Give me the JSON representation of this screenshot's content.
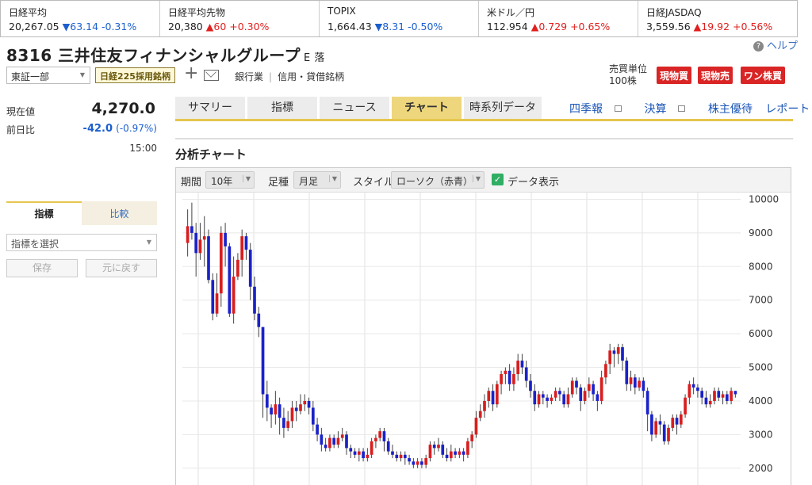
{
  "ticker": [
    {
      "name": "日経平均",
      "value": "20,267.05",
      "dir": "down",
      "change": "▼63.14 -0.31%"
    },
    {
      "name": "日経平均先物",
      "value": "20,380",
      "dir": "up",
      "change": "▲60 +0.30%"
    },
    {
      "name": "TOPIX",
      "value": "1,664.43",
      "dir": "down",
      "change": "▼8.31 -0.50%"
    },
    {
      "name": "米ドル／円",
      "value": "112.954",
      "dir": "up",
      "change": "▲0.729 +0.65%"
    },
    {
      "name": "日経JASDAQ",
      "value": "3,559.56",
      "dir": "up",
      "change": "▲19.92 +0.56%"
    }
  ],
  "help_label": "ヘルプ",
  "stock": {
    "code_name": "8316 三井住友フィナンシャルグループ",
    "market_mark": "E 落",
    "market": "東証一部",
    "nikkei225": "日経225採用銘柄",
    "industry": "銀行業",
    "margin": "信用・貸借銘柄",
    "unit_label": "売買単位",
    "unit_value": "100株",
    "buy_label": "現物買",
    "sell_label": "現物売",
    "one_label": "ワン株買"
  },
  "price": {
    "current_label": "現在値",
    "current": "4,270.0",
    "prev_label": "前日比",
    "change": "-42.0",
    "change_pct": "(-0.97%)",
    "time": "15:00"
  },
  "indicator_panel": {
    "tab_indicator": "指標",
    "tab_compare": "比較",
    "select_placeholder": "指標を選択",
    "save": "保存",
    "reset": "元に戻す"
  },
  "tabs": [
    "サマリー",
    "指標",
    "ニュース",
    "チャート",
    "時系列データ"
  ],
  "links": [
    "四季報",
    "決算",
    "株主優待",
    "レポート"
  ],
  "section_title": "分析チャート",
  "toolbar": {
    "period_label": "期間",
    "period_value": "10年",
    "interval_label": "足種",
    "interval_value": "月足",
    "style_label": "スタイル",
    "style_value": "ローソク（赤青）",
    "data_label": "データ表示"
  },
  "colors": {
    "up_candle": "#d81e1e",
    "down_candle": "#1a22c8",
    "accent_tab": "#eed67c"
  },
  "chart_data": {
    "type": "candlestick",
    "ylim": [
      1500,
      10200
    ],
    "yticks": [
      2000,
      3000,
      4000,
      5000,
      6000,
      7000,
      8000,
      9000,
      10000
    ],
    "candles": [
      [
        8700,
        9200,
        8300,
        9700
      ],
      [
        9200,
        9000,
        8800,
        9900
      ],
      [
        9000,
        8400,
        7700,
        9300
      ],
      [
        8400,
        8800,
        8200,
        9300
      ],
      [
        8800,
        8900,
        8000,
        9500
      ],
      [
        8900,
        7600,
        7500,
        9100
      ],
      [
        7600,
        6600,
        6400,
        7800
      ],
      [
        6600,
        7200,
        6500,
        7800
      ],
      [
        7200,
        9000,
        6800,
        9200
      ],
      [
        9000,
        8600,
        8000,
        9300
      ],
      [
        8600,
        6600,
        6500,
        8700
      ],
      [
        6600,
        7700,
        6300,
        8300
      ],
      [
        7700,
        8200,
        7600,
        8400
      ],
      [
        8200,
        8900,
        7700,
        9100
      ],
      [
        8900,
        8500,
        8200,
        9000
      ],
      [
        8500,
        7400,
        7000,
        8700
      ],
      [
        7400,
        6600,
        6400,
        7700
      ],
      [
        6600,
        6200,
        5900,
        6800
      ],
      [
        6200,
        4200,
        3500,
        6200
      ],
      [
        4200,
        3800,
        3400,
        4600
      ],
      [
        3800,
        3600,
        3200,
        3900
      ],
      [
        3600,
        3900,
        3300,
        4300
      ],
      [
        3900,
        3500,
        3000,
        4100
      ],
      [
        3500,
        3200,
        2900,
        3800
      ],
      [
        3200,
        3400,
        3100,
        3700
      ],
      [
        3400,
        3800,
        3200,
        4000
      ],
      [
        3800,
        3700,
        3400,
        4000
      ],
      [
        3700,
        3900,
        3600,
        4200
      ],
      [
        3900,
        4000,
        3700,
        4200
      ],
      [
        4000,
        3800,
        3600,
        4100
      ],
      [
        3800,
        3300,
        3100,
        4000
      ],
      [
        3300,
        3000,
        2800,
        3500
      ],
      [
        3000,
        2700,
        2500,
        3200
      ],
      [
        2700,
        2600,
        2500,
        2900
      ],
      [
        2600,
        2900,
        2500,
        3000
      ],
      [
        2900,
        2700,
        2600,
        3000
      ],
      [
        2700,
        2900,
        2600,
        3100
      ],
      [
        2900,
        3000,
        2800,
        3200
      ],
      [
        3000,
        2600,
        2400,
        3100
      ],
      [
        2600,
        2500,
        2300,
        2700
      ],
      [
        2500,
        2400,
        2300,
        2600
      ],
      [
        2400,
        2500,
        2200,
        2600
      ],
      [
        2500,
        2300,
        2200,
        2600
      ],
      [
        2300,
        2400,
        2200,
        2600
      ],
      [
        2400,
        2800,
        2300,
        2900
      ],
      [
        2800,
        2900,
        2600,
        3000
      ],
      [
        2900,
        3100,
        2800,
        3200
      ],
      [
        3100,
        2800,
        2500,
        3200
      ],
      [
        2800,
        2500,
        2400,
        2900
      ],
      [
        2500,
        2400,
        2300,
        2700
      ],
      [
        2400,
        2300,
        2200,
        2500
      ],
      [
        2300,
        2400,
        2200,
        2500
      ],
      [
        2400,
        2300,
        2100,
        2500
      ],
      [
        2300,
        2200,
        2100,
        2400
      ],
      [
        2200,
        2100,
        2000,
        2300
      ],
      [
        2100,
        2200,
        2000,
        2300
      ],
      [
        2200,
        2100,
        2000,
        2300
      ],
      [
        2100,
        2300,
        2000,
        2400
      ],
      [
        2300,
        2700,
        2200,
        2800
      ],
      [
        2700,
        2600,
        2400,
        2800
      ],
      [
        2600,
        2700,
        2500,
        2900
      ],
      [
        2700,
        2400,
        2300,
        2800
      ],
      [
        2400,
        2300,
        2200,
        2600
      ],
      [
        2300,
        2500,
        2200,
        2700
      ],
      [
        2500,
        2400,
        2300,
        2600
      ],
      [
        2400,
        2500,
        2300,
        2600
      ],
      [
        2500,
        2400,
        2200,
        2600
      ],
      [
        2400,
        2800,
        2300,
        2900
      ],
      [
        2800,
        3000,
        2600,
        3100
      ],
      [
        3000,
        3500,
        2900,
        3700
      ],
      [
        3500,
        3700,
        3400,
        3900
      ],
      [
        3700,
        4000,
        3500,
        4200
      ],
      [
        4000,
        4300,
        3800,
        4400
      ],
      [
        4300,
        3900,
        3700,
        4500
      ],
      [
        3900,
        4500,
        3800,
        4600
      ],
      [
        4500,
        4800,
        4200,
        4900
      ],
      [
        4800,
        4900,
        4500,
        5000
      ],
      [
        4900,
        4500,
        4300,
        5100
      ],
      [
        4500,
        4800,
        4300,
        5000
      ],
      [
        4800,
        5200,
        4600,
        5400
      ],
      [
        5200,
        5000,
        4800,
        5400
      ],
      [
        5000,
        4600,
        4400,
        5200
      ],
      [
        4600,
        4300,
        4100,
        4800
      ],
      [
        4300,
        3900,
        3700,
        4500
      ],
      [
        3900,
        4200,
        3800,
        4300
      ],
      [
        4200,
        4100,
        3900,
        4300
      ],
      [
        4100,
        4000,
        3800,
        4200
      ],
      [
        4000,
        4100,
        3900,
        4200
      ],
      [
        4100,
        4300,
        4000,
        4400
      ],
      [
        4300,
        4200,
        4000,
        4400
      ],
      [
        4200,
        3900,
        3800,
        4300
      ],
      [
        3900,
        4200,
        3800,
        4400
      ],
      [
        4200,
        4600,
        4100,
        4700
      ],
      [
        4600,
        4400,
        4200,
        4700
      ],
      [
        4400,
        4000,
        3700,
        4500
      ],
      [
        4000,
        4300,
        3900,
        4400
      ],
      [
        4300,
        4500,
        4100,
        4700
      ],
      [
        4500,
        4200,
        4000,
        4600
      ],
      [
        4200,
        4000,
        3700,
        4300
      ],
      [
        4000,
        4700,
        3900,
        4900
      ],
      [
        4700,
        5100,
        4500,
        5200
      ],
      [
        5100,
        5500,
        4800,
        5700
      ],
      [
        5500,
        5400,
        5000,
        5600
      ],
      [
        5400,
        5600,
        5100,
        5700
      ],
      [
        5600,
        5200,
        4900,
        5700
      ],
      [
        5200,
        4500,
        4300,
        5300
      ],
      [
        4500,
        4700,
        4300,
        4900
      ],
      [
        4700,
        4400,
        4200,
        4800
      ],
      [
        4400,
        4600,
        4300,
        4700
      ],
      [
        4600,
        4300,
        4100,
        4700
      ],
      [
        4300,
        3600,
        3100,
        4400
      ],
      [
        3600,
        3000,
        2800,
        3700
      ],
      [
        3000,
        3400,
        2900,
        3500
      ],
      [
        3400,
        3300,
        3000,
        3600
      ],
      [
        3300,
        2800,
        2700,
        3400
      ],
      [
        2800,
        3200,
        2700,
        3300
      ],
      [
        3200,
        3500,
        3100,
        3600
      ],
      [
        3500,
        3300,
        3000,
        3600
      ],
      [
        3300,
        3600,
        3200,
        3700
      ],
      [
        3600,
        4100,
        3500,
        4200
      ],
      [
        4100,
        4500,
        3900,
        4600
      ],
      [
        4500,
        4400,
        4200,
        4700
      ],
      [
        4400,
        4300,
        4100,
        4500
      ],
      [
        4300,
        4100,
        3900,
        4400
      ],
      [
        4100,
        3900,
        3800,
        4300
      ],
      [
        3900,
        4000,
        3800,
        4200
      ],
      [
        4000,
        4300,
        3900,
        4400
      ],
      [
        4300,
        4100,
        4000,
        4400
      ],
      [
        4100,
        4200,
        3900,
        4300
      ],
      [
        4200,
        4000,
        3900,
        4300
      ],
      [
        4000,
        4300,
        3900,
        4400
      ],
      [
        4300,
        4200,
        4100,
        4300
      ]
    ]
  }
}
